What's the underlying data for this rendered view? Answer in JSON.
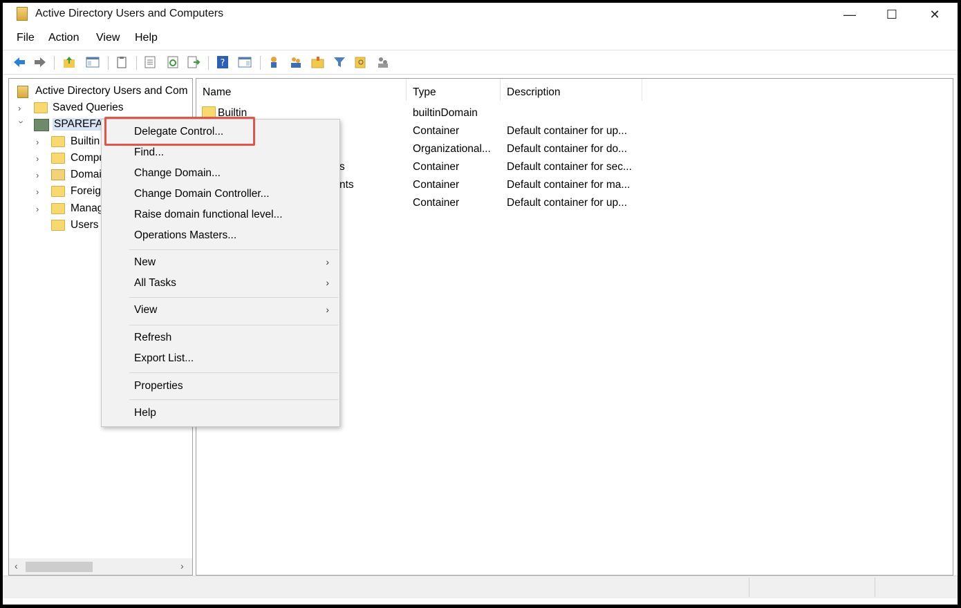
{
  "window": {
    "title": "Active Directory Users and Computers",
    "minimize_glyph": "—",
    "maximize_glyph": "☐",
    "close_glyph": "✕"
  },
  "menubar": {
    "file": "File",
    "action": "Action",
    "view": "View",
    "help": "Help"
  },
  "toolbar": {
    "icons": [
      "back-icon",
      "forward-icon",
      "up-folder-icon",
      "show-hide-console-tree-icon",
      "paste-icon",
      "properties-icon",
      "refresh-icon",
      "export-list-icon",
      "help-icon",
      "action-pane-icon",
      "add-user-icon",
      "add-group-icon",
      "add-ou-icon",
      "filter-icon",
      "find-icon",
      "delegate-icon"
    ]
  },
  "tree": {
    "root": "Active Directory Users and Com",
    "items": [
      {
        "label": "Saved Queries"
      },
      {
        "label": "SPAREFACT"
      },
      {
        "label": "Builtin"
      },
      {
        "label": "Compu"
      },
      {
        "label": "Domai"
      },
      {
        "label": "Foreig"
      },
      {
        "label": "Manag"
      },
      {
        "label": "Users"
      }
    ]
  },
  "list": {
    "headers": {
      "name": "Name",
      "type": "Type",
      "description": "Description"
    },
    "rows": [
      {
        "name": "Builtin",
        "type": "builtinDomain",
        "description": ""
      },
      {
        "name": "",
        "type": "Container",
        "description": "Default container for up..."
      },
      {
        "name": "",
        "type": "Organizational...",
        "description": "Default container for do..."
      },
      {
        "name": "s",
        "type": "Container",
        "description": "Default container for sec..."
      },
      {
        "name": "nts",
        "type": "Container",
        "description": "Default container for ma..."
      },
      {
        "name": "",
        "type": "Container",
        "description": "Default container for up..."
      }
    ]
  },
  "context_menu": {
    "items": [
      {
        "label": "Delegate Control..."
      },
      {
        "label": "Find..."
      },
      {
        "label": "Change Domain..."
      },
      {
        "label": "Change Domain Controller..."
      },
      {
        "label": "Raise domain functional level..."
      },
      {
        "label": "Operations Masters..."
      },
      {
        "label": "New",
        "submenu": true
      },
      {
        "label": "All Tasks",
        "submenu": true
      },
      {
        "label": "View",
        "submenu": true
      },
      {
        "label": "Refresh"
      },
      {
        "label": "Export List..."
      },
      {
        "label": "Properties"
      },
      {
        "label": "Help"
      }
    ],
    "submenu_arrow": "›",
    "highlight_color": "#e0574a"
  },
  "scrollbar": {
    "left_arrow": "‹",
    "right_arrow": "›"
  }
}
